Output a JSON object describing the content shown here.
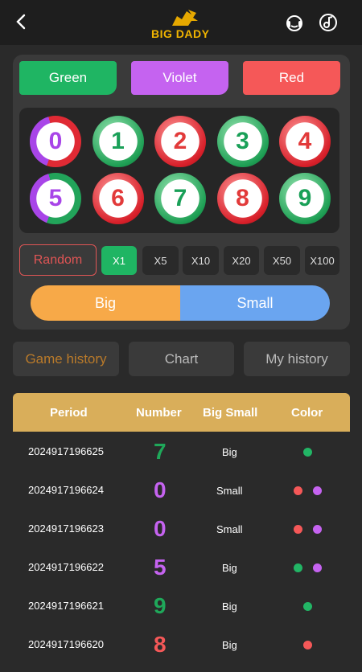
{
  "header": {
    "logo_text": "BIG DADY"
  },
  "colors": {
    "green_btn": "Green",
    "violet_btn": "Violet",
    "red_btn": "Red",
    "green": "#22b565",
    "violet": "#c563f0",
    "red": "#f55858"
  },
  "balls": [
    {
      "n": "0",
      "kind": "rv"
    },
    {
      "n": "1",
      "kind": "green"
    },
    {
      "n": "2",
      "kind": "red"
    },
    {
      "n": "3",
      "kind": "green"
    },
    {
      "n": "4",
      "kind": "red"
    },
    {
      "n": "5",
      "kind": "gv"
    },
    {
      "n": "6",
      "kind": "red"
    },
    {
      "n": "7",
      "kind": "green"
    },
    {
      "n": "8",
      "kind": "red"
    },
    {
      "n": "9",
      "kind": "green"
    }
  ],
  "multipliers": {
    "random": "Random",
    "items": [
      "X1",
      "X5",
      "X10",
      "X20",
      "X50",
      "X100"
    ],
    "selected": "X1"
  },
  "bigsmall": {
    "big": "Big",
    "small": "Small"
  },
  "tabs": {
    "game_history": "Game history",
    "chart": "Chart",
    "my_history": "My history",
    "active": "Game history"
  },
  "table": {
    "headers": {
      "period": "Period",
      "number": "Number",
      "bigsmall": "Big Small",
      "color": "Color"
    },
    "rows": [
      {
        "period": "2024917196625",
        "number": "7",
        "num_color": "#1fa85a",
        "bs": "Big",
        "dots": [
          "#22b565"
        ]
      },
      {
        "period": "2024917196624",
        "number": "0",
        "num_color": "#c563f0",
        "bs": "Small",
        "dots": [
          "#f55858",
          "#c563f0"
        ]
      },
      {
        "period": "2024917196623",
        "number": "0",
        "num_color": "#c563f0",
        "bs": "Small",
        "dots": [
          "#f55858",
          "#c563f0"
        ]
      },
      {
        "period": "2024917196622",
        "number": "5",
        "num_color": "#c563f0",
        "bs": "Big",
        "dots": [
          "#22b565",
          "#c563f0"
        ]
      },
      {
        "period": "2024917196621",
        "number": "9",
        "num_color": "#1fa85a",
        "bs": "Big",
        "dots": [
          "#22b565"
        ]
      },
      {
        "period": "2024917196620",
        "number": "8",
        "num_color": "#f55858",
        "bs": "Big",
        "dots": [
          "#f55858"
        ]
      }
    ]
  }
}
